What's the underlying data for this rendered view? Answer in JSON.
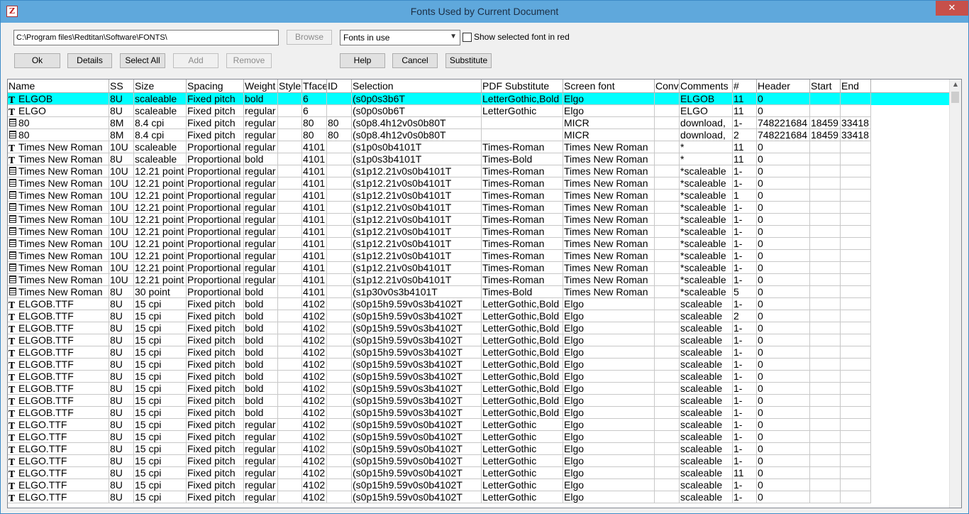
{
  "window": {
    "title": "Fonts Used by Current Document",
    "close_label": "✕"
  },
  "toolbar": {
    "path_value": "C:\\Program files\\Redtitan\\Software\\FONTS\\",
    "browse_label": "Browse",
    "filter_selected": "Fonts in use",
    "show_red_label": "Show selected font in red",
    "ok_label": "Ok",
    "details_label": "Details",
    "select_all_label": "Select All",
    "add_label": "Add",
    "remove_label": "Remove",
    "help_label": "Help",
    "cancel_label": "Cancel",
    "substitute_label": "Substitute"
  },
  "table": {
    "columns": [
      "Name",
      "SS",
      "Size",
      "Spacing",
      "Weight",
      "Style",
      "Tface",
      "ID",
      "Selection",
      "PDF Substitute",
      "Screen font",
      "Conv",
      "Comments",
      "#",
      "Header",
      "Start",
      "End"
    ],
    "rows": [
      {
        "icon": "tt",
        "selected": true,
        "c": [
          "ELGOB",
          "8U",
          "scaleable",
          "Fixed pitch",
          "bold",
          "",
          "6",
          "",
          "(s0p0s3b6T",
          "LetterGothic,Bold",
          "Elgo",
          "",
          "ELGOB",
          "11",
          "0",
          "",
          ""
        ]
      },
      {
        "icon": "tt",
        "c": [
          "ELGO",
          "8U",
          "scaleable",
          "Fixed pitch",
          "regular",
          "",
          "6",
          "",
          "(s0p0s0b6T",
          "LetterGothic",
          "Elgo",
          "",
          "ELGO",
          "11",
          "0",
          "",
          ""
        ]
      },
      {
        "icon": "printer",
        "c": [
          "80",
          "8M",
          "8.4 cpi",
          "Fixed pitch",
          "regular",
          "",
          "80",
          "80",
          "(s0p8.4h12v0s0b80T",
          "",
          "MICR",
          "",
          "download,",
          "1-",
          "748221684",
          "18459",
          "33418"
        ]
      },
      {
        "icon": "printer",
        "c": [
          "80",
          "8M",
          "8.4 cpi",
          "Fixed pitch",
          "regular",
          "",
          "80",
          "80",
          "(s0p8.4h12v0s0b80T",
          "",
          "MICR",
          "",
          "download,",
          "2",
          "748221684",
          "18459",
          "33418"
        ]
      },
      {
        "icon": "tt",
        "c": [
          "Times New Roman",
          "10U",
          "scaleable",
          "Proportional",
          "regular",
          "",
          "4101",
          "",
          "(s1p0s0b4101T",
          "Times-Roman",
          "Times New Roman",
          "",
          "*",
          "11",
          "0",
          "",
          ""
        ]
      },
      {
        "icon": "tt",
        "c": [
          "Times New Roman",
          "8U",
          "scaleable",
          "Proportional",
          "bold",
          "",
          "4101",
          "",
          "(s1p0s3b4101T",
          "Times-Bold",
          "Times New Roman",
          "",
          "*",
          "11",
          "0",
          "",
          ""
        ]
      },
      {
        "icon": "printer",
        "c": [
          "Times New Roman",
          "10U",
          "12.21 point",
          "Proportional",
          "regular",
          "",
          "4101",
          "",
          "(s1p12.21v0s0b4101T",
          "Times-Roman",
          "Times New Roman",
          "",
          "*scaleable",
          "1-",
          "0",
          "",
          ""
        ]
      },
      {
        "icon": "printer",
        "c": [
          "Times New Roman",
          "10U",
          "12.21 point",
          "Proportional",
          "regular",
          "",
          "4101",
          "",
          "(s1p12.21v0s0b4101T",
          "Times-Roman",
          "Times New Roman",
          "",
          "*scaleable",
          "1-",
          "0",
          "",
          ""
        ]
      },
      {
        "icon": "printer",
        "c": [
          "Times New Roman",
          "10U",
          "12.21 point",
          "Proportional",
          "regular",
          "",
          "4101",
          "",
          "(s1p12.21v0s0b4101T",
          "Times-Roman",
          "Times New Roman",
          "",
          "*scaleable",
          "1",
          "0",
          "",
          ""
        ]
      },
      {
        "icon": "printer",
        "c": [
          "Times New Roman",
          "10U",
          "12.21 point",
          "Proportional",
          "regular",
          "",
          "4101",
          "",
          "(s1p12.21v0s0b4101T",
          "Times-Roman",
          "Times New Roman",
          "",
          "*scaleable",
          "1-",
          "0",
          "",
          ""
        ]
      },
      {
        "icon": "printer",
        "c": [
          "Times New Roman",
          "10U",
          "12.21 point",
          "Proportional",
          "regular",
          "",
          "4101",
          "",
          "(s1p12.21v0s0b4101T",
          "Times-Roman",
          "Times New Roman",
          "",
          "*scaleable",
          "1-",
          "0",
          "",
          ""
        ]
      },
      {
        "icon": "printer",
        "c": [
          "Times New Roman",
          "10U",
          "12.21 point",
          "Proportional",
          "regular",
          "",
          "4101",
          "",
          "(s1p12.21v0s0b4101T",
          "Times-Roman",
          "Times New Roman",
          "",
          "*scaleable",
          "1-",
          "0",
          "",
          ""
        ]
      },
      {
        "icon": "printer",
        "c": [
          "Times New Roman",
          "10U",
          "12.21 point",
          "Proportional",
          "regular",
          "",
          "4101",
          "",
          "(s1p12.21v0s0b4101T",
          "Times-Roman",
          "Times New Roman",
          "",
          "*scaleable",
          "1-",
          "0",
          "",
          ""
        ]
      },
      {
        "icon": "printer",
        "c": [
          "Times New Roman",
          "10U",
          "12.21 point",
          "Proportional",
          "regular",
          "",
          "4101",
          "",
          "(s1p12.21v0s0b4101T",
          "Times-Roman",
          "Times New Roman",
          "",
          "*scaleable",
          "1-",
          "0",
          "",
          ""
        ]
      },
      {
        "icon": "printer",
        "c": [
          "Times New Roman",
          "10U",
          "12.21 point",
          "Proportional",
          "regular",
          "",
          "4101",
          "",
          "(s1p12.21v0s0b4101T",
          "Times-Roman",
          "Times New Roman",
          "",
          "*scaleable",
          "1-",
          "0",
          "",
          ""
        ]
      },
      {
        "icon": "printer",
        "c": [
          "Times New Roman",
          "10U",
          "12.21 point",
          "Proportional",
          "regular",
          "",
          "4101",
          "",
          "(s1p12.21v0s0b4101T",
          "Times-Roman",
          "Times New Roman",
          "",
          "*scaleable",
          "1-",
          "0",
          "",
          ""
        ]
      },
      {
        "icon": "printer",
        "c": [
          "Times New Roman",
          "8U",
          "30 point",
          "Proportional",
          "bold",
          "",
          "4101",
          "",
          "(s1p30v0s3b4101T",
          "Times-Bold",
          "Times New Roman",
          "",
          "*scaleable",
          "5",
          "0",
          "",
          ""
        ]
      },
      {
        "icon": "tt",
        "c": [
          "ELGOB.TTF",
          "8U",
          "15 cpi",
          "Fixed pitch",
          "bold",
          "",
          "4102",
          "",
          "(s0p15h9.59v0s3b4102T",
          "LetterGothic,Bold",
          "Elgo",
          "",
          "scaleable",
          "1-",
          "0",
          "",
          ""
        ]
      },
      {
        "icon": "tt",
        "c": [
          "ELGOB.TTF",
          "8U",
          "15 cpi",
          "Fixed pitch",
          "bold",
          "",
          "4102",
          "",
          "(s0p15h9.59v0s3b4102T",
          "LetterGothic,Bold",
          "Elgo",
          "",
          "scaleable",
          "2",
          "0",
          "",
          ""
        ]
      },
      {
        "icon": "tt",
        "c": [
          "ELGOB.TTF",
          "8U",
          "15 cpi",
          "Fixed pitch",
          "bold",
          "",
          "4102",
          "",
          "(s0p15h9.59v0s3b4102T",
          "LetterGothic,Bold",
          "Elgo",
          "",
          "scaleable",
          "1-",
          "0",
          "",
          ""
        ]
      },
      {
        "icon": "tt",
        "c": [
          "ELGOB.TTF",
          "8U",
          "15 cpi",
          "Fixed pitch",
          "bold",
          "",
          "4102",
          "",
          "(s0p15h9.59v0s3b4102T",
          "LetterGothic,Bold",
          "Elgo",
          "",
          "scaleable",
          "1-",
          "0",
          "",
          ""
        ]
      },
      {
        "icon": "tt",
        "c": [
          "ELGOB.TTF",
          "8U",
          "15 cpi",
          "Fixed pitch",
          "bold",
          "",
          "4102",
          "",
          "(s0p15h9.59v0s3b4102T",
          "LetterGothic,Bold",
          "Elgo",
          "",
          "scaleable",
          "1-",
          "0",
          "",
          ""
        ]
      },
      {
        "icon": "tt",
        "c": [
          "ELGOB.TTF",
          "8U",
          "15 cpi",
          "Fixed pitch",
          "bold",
          "",
          "4102",
          "",
          "(s0p15h9.59v0s3b4102T",
          "LetterGothic,Bold",
          "Elgo",
          "",
          "scaleable",
          "1-",
          "0",
          "",
          ""
        ]
      },
      {
        "icon": "tt",
        "c": [
          "ELGOB.TTF",
          "8U",
          "15 cpi",
          "Fixed pitch",
          "bold",
          "",
          "4102",
          "",
          "(s0p15h9.59v0s3b4102T",
          "LetterGothic,Bold",
          "Elgo",
          "",
          "scaleable",
          "1-",
          "0",
          "",
          ""
        ]
      },
      {
        "icon": "tt",
        "c": [
          "ELGOB.TTF",
          "8U",
          "15 cpi",
          "Fixed pitch",
          "bold",
          "",
          "4102",
          "",
          "(s0p15h9.59v0s3b4102T",
          "LetterGothic,Bold",
          "Elgo",
          "",
          "scaleable",
          "1-",
          "0",
          "",
          ""
        ]
      },
      {
        "icon": "tt",
        "c": [
          "ELGOB.TTF",
          "8U",
          "15 cpi",
          "Fixed pitch",
          "bold",
          "",
          "4102",
          "",
          "(s0p15h9.59v0s3b4102T",
          "LetterGothic,Bold",
          "Elgo",
          "",
          "scaleable",
          "1-",
          "0",
          "",
          ""
        ]
      },
      {
        "icon": "tt",
        "c": [
          "ELGOB.TTF",
          "8U",
          "15 cpi",
          "Fixed pitch",
          "bold",
          "",
          "4102",
          "",
          "(s0p15h9.59v0s3b4102T",
          "LetterGothic,Bold",
          "Elgo",
          "",
          "scaleable",
          "1-",
          "0",
          "",
          ""
        ]
      },
      {
        "icon": "tt",
        "c": [
          "ELGO.TTF",
          "8U",
          "15 cpi",
          "Fixed pitch",
          "regular",
          "",
          "4102",
          "",
          "(s0p15h9.59v0s0b4102T",
          "LetterGothic",
          "Elgo",
          "",
          "scaleable",
          "1-",
          "0",
          "",
          ""
        ]
      },
      {
        "icon": "tt",
        "c": [
          "ELGO.TTF",
          "8U",
          "15 cpi",
          "Fixed pitch",
          "regular",
          "",
          "4102",
          "",
          "(s0p15h9.59v0s0b4102T",
          "LetterGothic",
          "Elgo",
          "",
          "scaleable",
          "1-",
          "0",
          "",
          ""
        ]
      },
      {
        "icon": "tt",
        "c": [
          "ELGO.TTF",
          "8U",
          "15 cpi",
          "Fixed pitch",
          "regular",
          "",
          "4102",
          "",
          "(s0p15h9.59v0s0b4102T",
          "LetterGothic",
          "Elgo",
          "",
          "scaleable",
          "1-",
          "0",
          "",
          ""
        ]
      },
      {
        "icon": "tt",
        "c": [
          "ELGO.TTF",
          "8U",
          "15 cpi",
          "Fixed pitch",
          "regular",
          "",
          "4102",
          "",
          "(s0p15h9.59v0s0b4102T",
          "LetterGothic",
          "Elgo",
          "",
          "scaleable",
          "1-",
          "0",
          "",
          ""
        ]
      },
      {
        "icon": "tt",
        "c": [
          "ELGO.TTF",
          "8U",
          "15 cpi",
          "Fixed pitch",
          "regular",
          "",
          "4102",
          "",
          "(s0p15h9.59v0s0b4102T",
          "LetterGothic",
          "Elgo",
          "",
          "scaleable",
          "11",
          "0",
          "",
          ""
        ]
      },
      {
        "icon": "tt",
        "c": [
          "ELGO.TTF",
          "8U",
          "15 cpi",
          "Fixed pitch",
          "regular",
          "",
          "4102",
          "",
          "(s0p15h9.59v0s0b4102T",
          "LetterGothic",
          "Elgo",
          "",
          "scaleable",
          "1-",
          "0",
          "",
          ""
        ]
      },
      {
        "icon": "tt",
        "c": [
          "ELGO.TTF",
          "8U",
          "15 cpi",
          "Fixed pitch",
          "regular",
          "",
          "4102",
          "",
          "(s0p15h9.59v0s0b4102T",
          "LetterGothic",
          "Elgo",
          "",
          "scaleable",
          "1-",
          "0",
          "",
          ""
        ]
      }
    ]
  }
}
